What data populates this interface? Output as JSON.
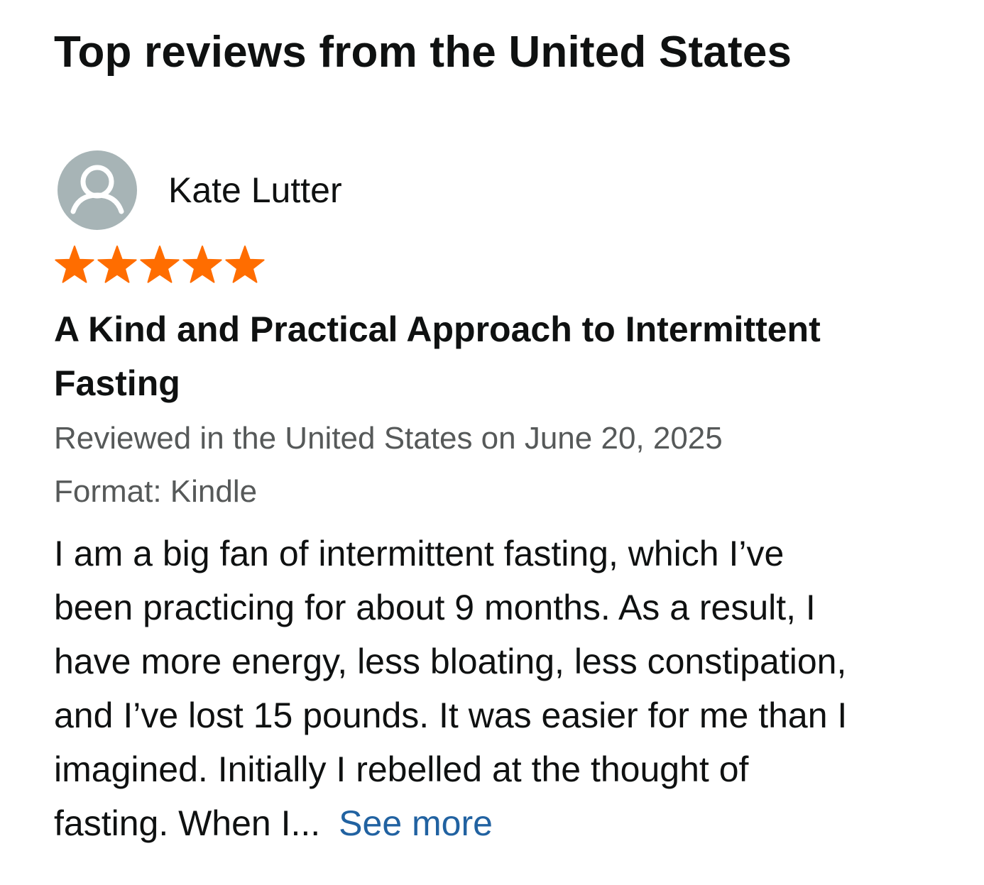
{
  "section": {
    "title": "Top reviews from the United States"
  },
  "review": {
    "reviewer_name": "Kate Lutter",
    "rating": 5,
    "rating_max": 5,
    "star_color": "#ff6d00",
    "title_line1": "A Kind and Practical Approach to Intermittent",
    "title_line2": "Fasting",
    "reviewed_line": "Reviewed in the United States on June 20, 2025",
    "format_line": "Format: Kindle",
    "body_lines": [
      "I am a big fan of intermittent fasting, which I’ve",
      "been practicing for about 9 months. As a result, I",
      "have more energy, less bloating, less constipation,",
      "and I’ve lost 15 pounds. It was easier for me than I",
      "imagined. Initially I rebelled at the thought of",
      "fasting. When I..."
    ],
    "see_more_label": "See more",
    "link_color": "#2162a1"
  },
  "icons": {
    "avatar": "user-silhouette-icon",
    "star": "star-icon"
  }
}
